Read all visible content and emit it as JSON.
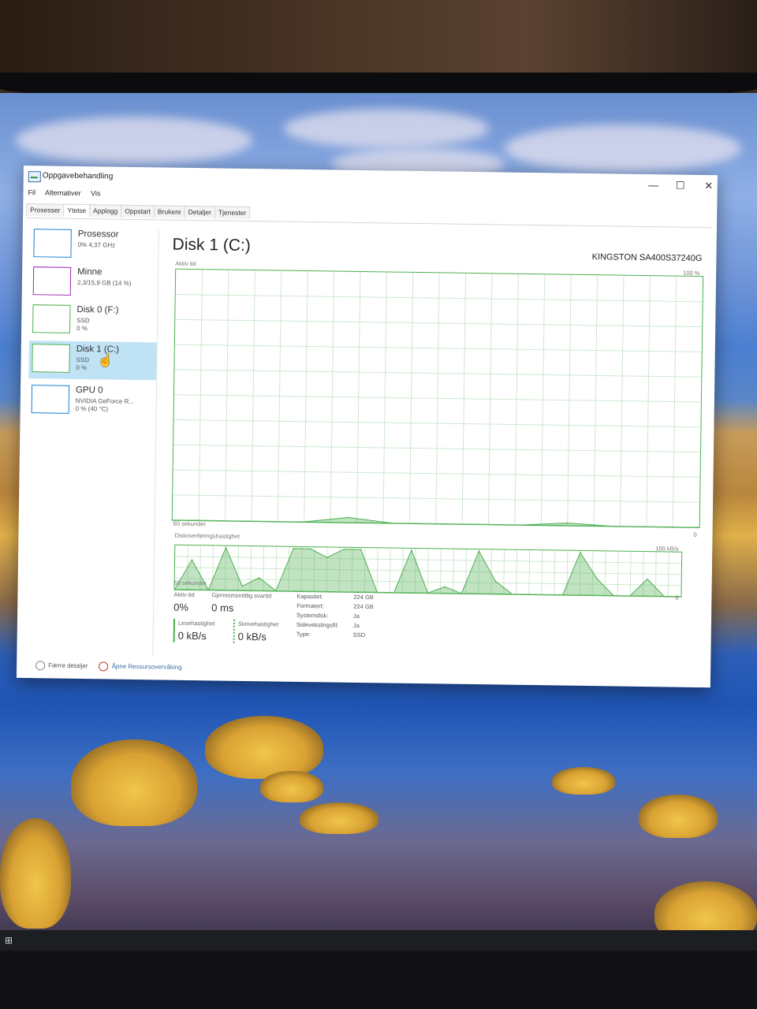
{
  "window": {
    "title": "Oppgavebehandling",
    "minimize_glyph": "—",
    "maximize_glyph": "☐",
    "close_glyph": "✕"
  },
  "menu": [
    "Fil",
    "Alternativer",
    "Vis"
  ],
  "tabs": [
    "Prosesser",
    "Ytelse",
    "Applogg",
    "Oppstart",
    "Brukere",
    "Detaljer",
    "Tjenester"
  ],
  "active_tab": "Ytelse",
  "sidebar": {
    "items": [
      {
        "name": "Prosessor",
        "line1": "0% 4,37 GHz",
        "line2": "",
        "color": "#1a7fd6"
      },
      {
        "name": "Minne",
        "line1": "2,3/15,9 GB (14 %)",
        "line2": "",
        "color": "#9c27b0"
      },
      {
        "name": "Disk 0 (F:)",
        "line1": "SSD",
        "line2": "0 %",
        "color": "#4caf50"
      },
      {
        "name": "Disk 1 (C:)",
        "line1": "SSD",
        "line2": "0 %",
        "color": "#4caf50"
      },
      {
        "name": "GPU 0",
        "line1": "NVIDIA GeForce R...",
        "line2": "0 % (40 °C)",
        "color": "#1a7fd6"
      }
    ],
    "active_index": 3
  },
  "main": {
    "title": "Disk 1 (C:)",
    "model": "KINGSTON SA400S37240G",
    "chart1": {
      "label": "Aktiv tid",
      "max_label": "100 %",
      "min_label": "0",
      "time_label": "60 sekunder"
    },
    "chart2": {
      "label": "Diskoverføringshastighet",
      "max_label": "100 kB/s",
      "min_label": "0",
      "time_label": "60 sekunder"
    }
  },
  "chart_data": [
    {
      "type": "area",
      "title": "Aktiv tid",
      "xlabel": "60 sekunder",
      "ylabel": "",
      "ylim": [
        0,
        100
      ],
      "x": [
        0,
        5,
        10,
        15,
        20,
        25,
        30,
        35,
        40,
        45,
        50,
        55,
        60
      ],
      "series": [
        {
          "values": [
            0,
            0,
            0,
            0,
            2,
            0,
            0,
            0,
            0,
            1,
            0,
            0,
            0
          ]
        }
      ]
    },
    {
      "type": "area",
      "title": "Diskoverføringshastighet",
      "xlabel": "60 sekunder",
      "ylabel": "",
      "ylim": [
        0,
        100
      ],
      "x": [
        0,
        2,
        4,
        6,
        8,
        10,
        12,
        14,
        16,
        18,
        20,
        22,
        24,
        26,
        28,
        30,
        32,
        34,
        36,
        38,
        40,
        42,
        44,
        46,
        48,
        50,
        52,
        54,
        56,
        58,
        60
      ],
      "series": [
        {
          "values": [
            0,
            70,
            0,
            100,
            10,
            30,
            0,
            100,
            100,
            80,
            100,
            100,
            0,
            0,
            100,
            0,
            15,
            0,
            100,
            30,
            0,
            0,
            0,
            0,
            100,
            40,
            0,
            0,
            40,
            0,
            0
          ]
        }
      ]
    }
  ],
  "stats": {
    "active_time_label": "Aktiv tid",
    "active_time_value": "0%",
    "response_label": "Gjennomsnittlig svartid",
    "response_value": "0 ms",
    "read_label": "Lesehastighet",
    "read_value": "0 kB/s",
    "write_label": "Skrivehastighet",
    "write_value": "0 kB/s",
    "details": [
      {
        "k": "Kapasitet:",
        "v": "224 GB"
      },
      {
        "k": "Formatert:",
        "v": "224 GB"
      },
      {
        "k": "Systemdisk:",
        "v": "Ja"
      },
      {
        "k": "Sidevekslingsfil:",
        "v": "Ja"
      },
      {
        "k": "Type:",
        "v": "SSD"
      }
    ]
  },
  "footer": {
    "fewer_details": "Færre detaljer",
    "resource_monitor": "Åpne Ressursovervåking"
  },
  "colors": {
    "disk_green": "#4caf50",
    "selected_bg": "#bfe3f5"
  }
}
